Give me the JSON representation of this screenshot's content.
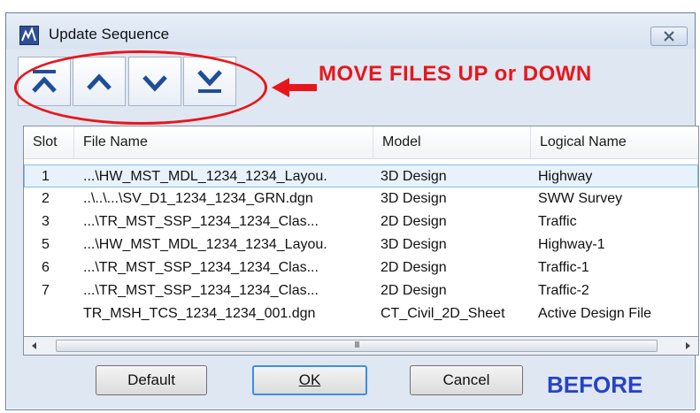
{
  "window": {
    "title": "Update Sequence"
  },
  "annotation": {
    "text": "MOVE FILES UP or DOWN",
    "before_label": "BEFORE",
    "color": "#e8161b",
    "before_color": "#2743c5"
  },
  "toolbar": {
    "buttons": [
      {
        "name": "move-to-top",
        "icon": "move-to-top-icon"
      },
      {
        "name": "move-up",
        "icon": "chevron-up-icon"
      },
      {
        "name": "move-down",
        "icon": "chevron-down-icon"
      },
      {
        "name": "move-to-bottom",
        "icon": "move-to-bottom-icon"
      }
    ],
    "icon_color": "#1f4e97"
  },
  "table": {
    "columns": [
      "Slot",
      "File Name",
      "Model",
      "Logical Name"
    ],
    "rows": [
      {
        "slot": "1",
        "file": "...\\HW_MST_MDL_1234_1234_Layou.",
        "model": "3D Design",
        "logical": "Highway",
        "selected": true
      },
      {
        "slot": "2",
        "file": "..\\..\\...\\SV_D1_1234_1234_GRN.dgn",
        "model": "3D Design",
        "logical": "SWW Survey"
      },
      {
        "slot": "3",
        "file": "...\\TR_MST_SSP_1234_1234_Clas...",
        "model": "2D Design",
        "logical": "Traffic"
      },
      {
        "slot": "5",
        "file": "...\\HW_MST_MDL_1234_1234_Layou.",
        "model": "3D Design",
        "logical": "Highway-1"
      },
      {
        "slot": "6",
        "file": "...\\TR_MST_SSP_1234_1234_Clas...",
        "model": "2D Design",
        "logical": "Traffic-1"
      },
      {
        "slot": "7",
        "file": "...\\TR_MST_SSP_1234_1234_Clas...",
        "model": "2D Design",
        "logical": "Traffic-2"
      },
      {
        "slot": "",
        "file": "TR_MSH_TCS_1234_1234_001.dgn",
        "model": "CT_Civil_2D_Sheet",
        "logical": "Active Design File"
      }
    ]
  },
  "scrollbar": {
    "grip": "III"
  },
  "buttons": {
    "default": "Default",
    "ok": "OK",
    "cancel": "Cancel"
  }
}
